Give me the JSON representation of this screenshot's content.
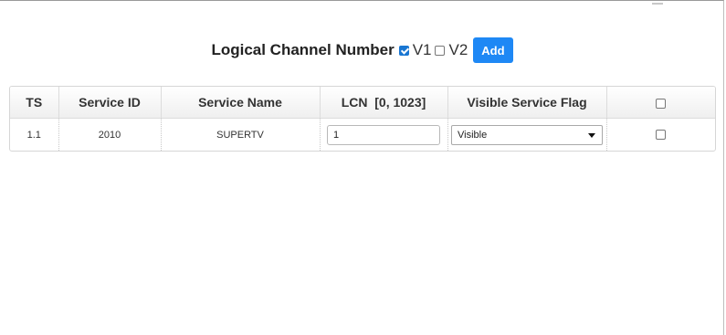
{
  "header": {
    "title": "Logical Channel Number",
    "options": [
      {
        "label": "V1",
        "checked": true
      },
      {
        "label": "V2",
        "checked": false
      }
    ],
    "add_label": "Add"
  },
  "table": {
    "columns": [
      "TS",
      "Service ID",
      "Service Name",
      "LCN  [0, 1023]",
      "Visible Service Flag"
    ],
    "rows": [
      {
        "ts": "1.1",
        "service_id": "2010",
        "service_name": "SUPERTV",
        "lcn": "1",
        "visible_flag": "Visible",
        "selected": false
      }
    ]
  },
  "colors": {
    "accent": "#1e88f5"
  },
  "icons": {
    "dropdown": "caret-down-icon"
  }
}
